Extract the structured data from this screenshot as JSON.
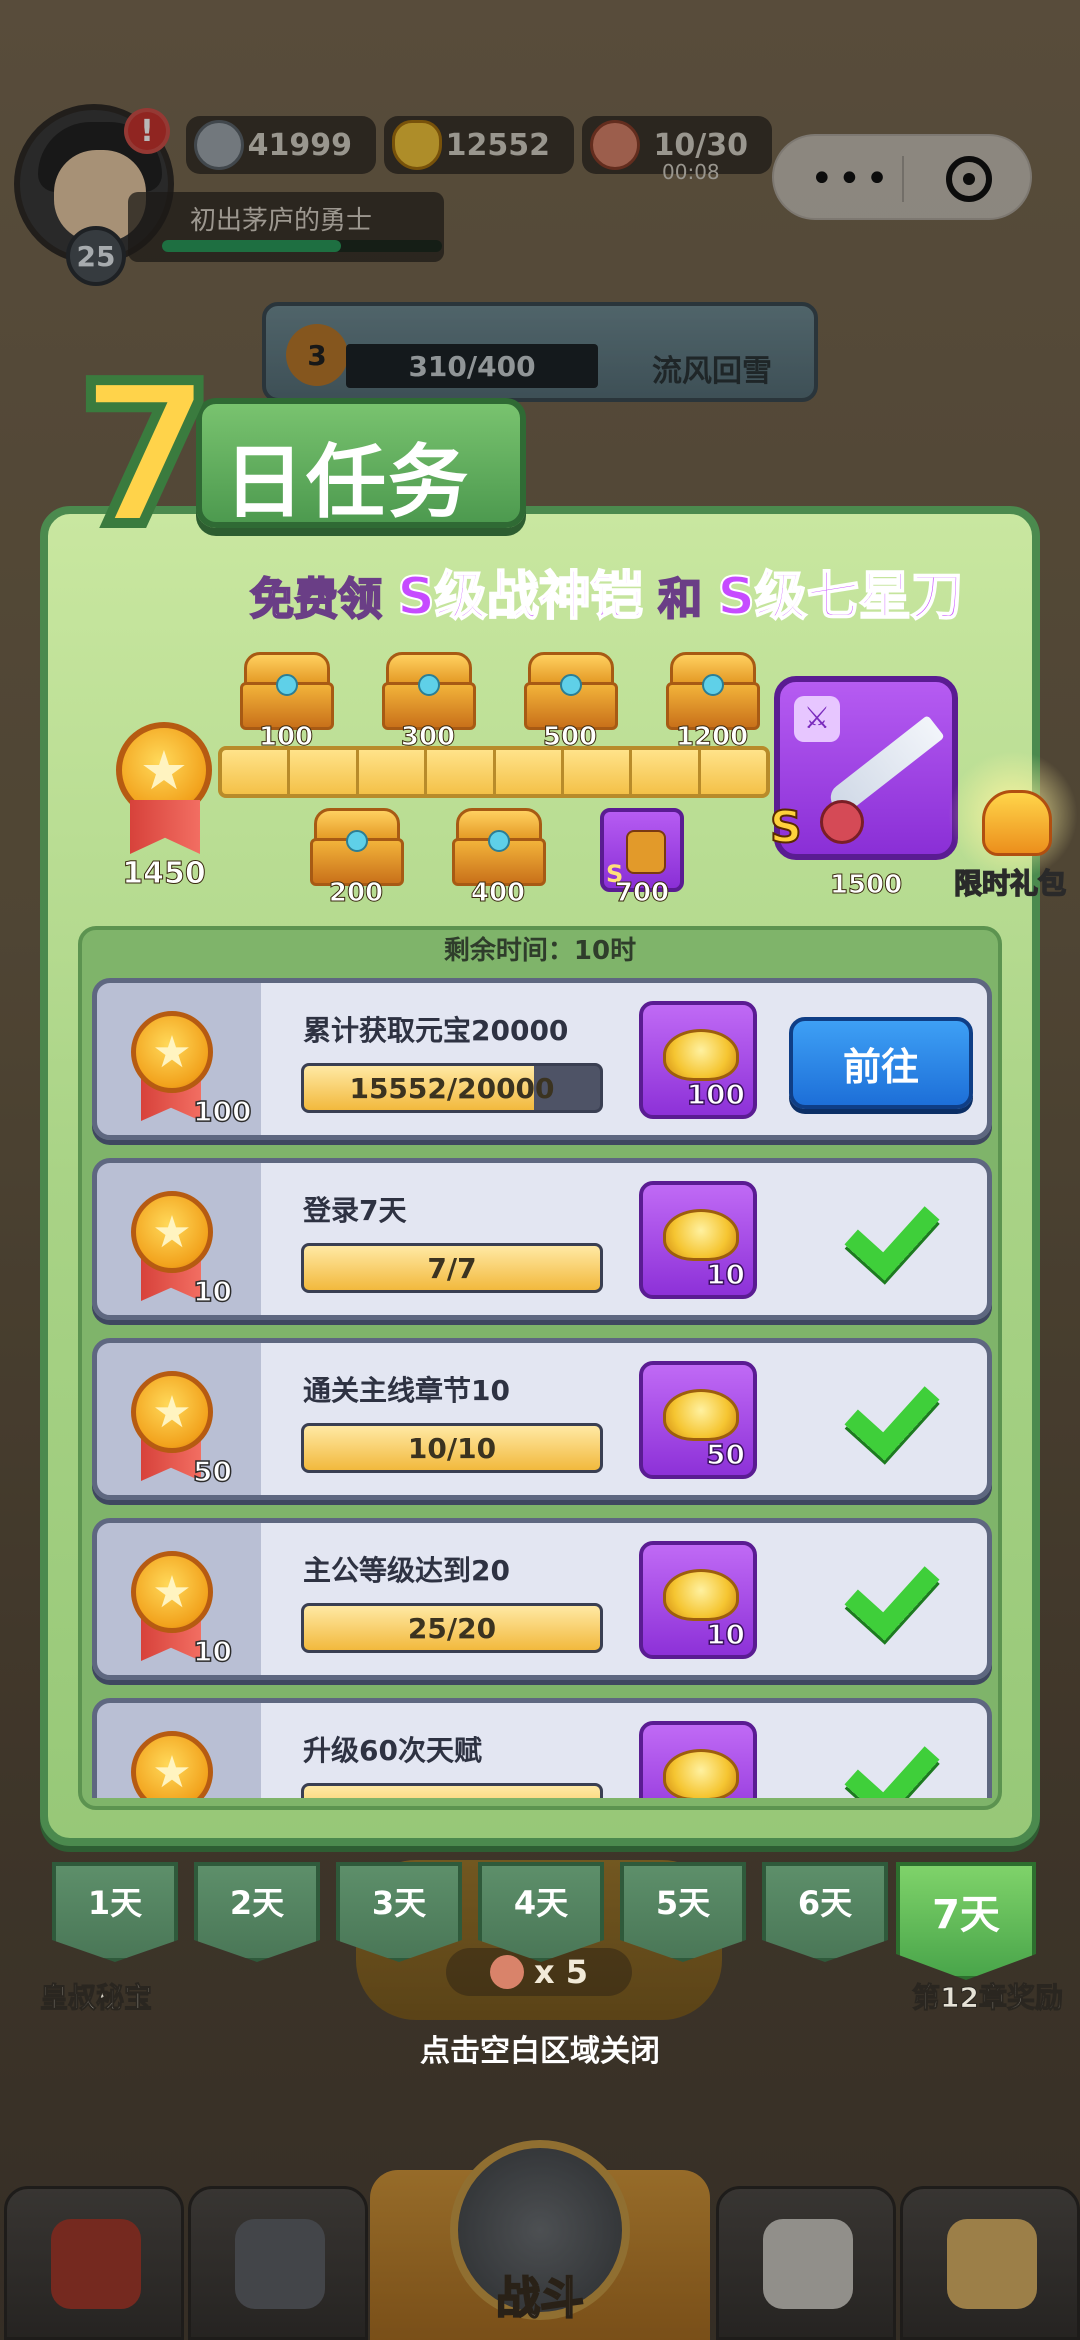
{
  "hud": {
    "level": "25",
    "alert": "!",
    "title": "初出茅庐的勇士",
    "silver": "41999",
    "gold": "12552",
    "stamina": "10/30",
    "stamina_timer": "00:08",
    "region_medal": "3",
    "region_progress": "310/400",
    "region_name": "流风回雪",
    "colors": {
      "accent_green": "#4b8a4e",
      "gold": "#f4c148",
      "purple": "#8d31d8",
      "blue": "#1d6fd8"
    }
  },
  "modal": {
    "title_number": "7",
    "title_text": "日任务",
    "subtitle_prefix": "免费领",
    "subtitle_item1": "S级战神铠",
    "subtitle_and": "和",
    "subtitle_item2": "S级七星刀",
    "total_points": "1450",
    "milestones_top": [
      "100",
      "300",
      "500",
      "1200"
    ],
    "milestones_bottom": [
      "200",
      "400",
      "700"
    ],
    "final_milestone": "1500",
    "mini_card_grade": "S",
    "sword_grade": "S",
    "gift_label": "限时礼包",
    "remaining_time": "剩余时间：10时",
    "tasks": [
      {
        "points": "100",
        "name": "累计获取元宝20000",
        "progress": "15552/20000",
        "fraction": 0.7776,
        "reward": "100",
        "action": "前往",
        "done": false
      },
      {
        "points": "10",
        "name": "登录7天",
        "progress": "7/7",
        "fraction": 1,
        "reward": "10",
        "done": true
      },
      {
        "points": "50",
        "name": "通关主线章节10",
        "progress": "10/10",
        "fraction": 1,
        "reward": "50",
        "done": true
      },
      {
        "points": "10",
        "name": "主公等级达到20",
        "progress": "25/20",
        "fraction": 1,
        "reward": "10",
        "done": true
      },
      {
        "points": "",
        "name": "升级60次天赋",
        "progress": "",
        "fraction": 1,
        "reward": "",
        "done": true
      }
    ],
    "days": [
      "1天",
      "2天",
      "3天",
      "4天",
      "5天",
      "6天",
      "7天"
    ],
    "active_day": "7天"
  },
  "bottom": {
    "left_label": "皇叔秘宝",
    "right_label": "第12章奖励",
    "meat_count": "x 5",
    "close_hint": "点击空白区域关闭",
    "battle": "战斗"
  }
}
